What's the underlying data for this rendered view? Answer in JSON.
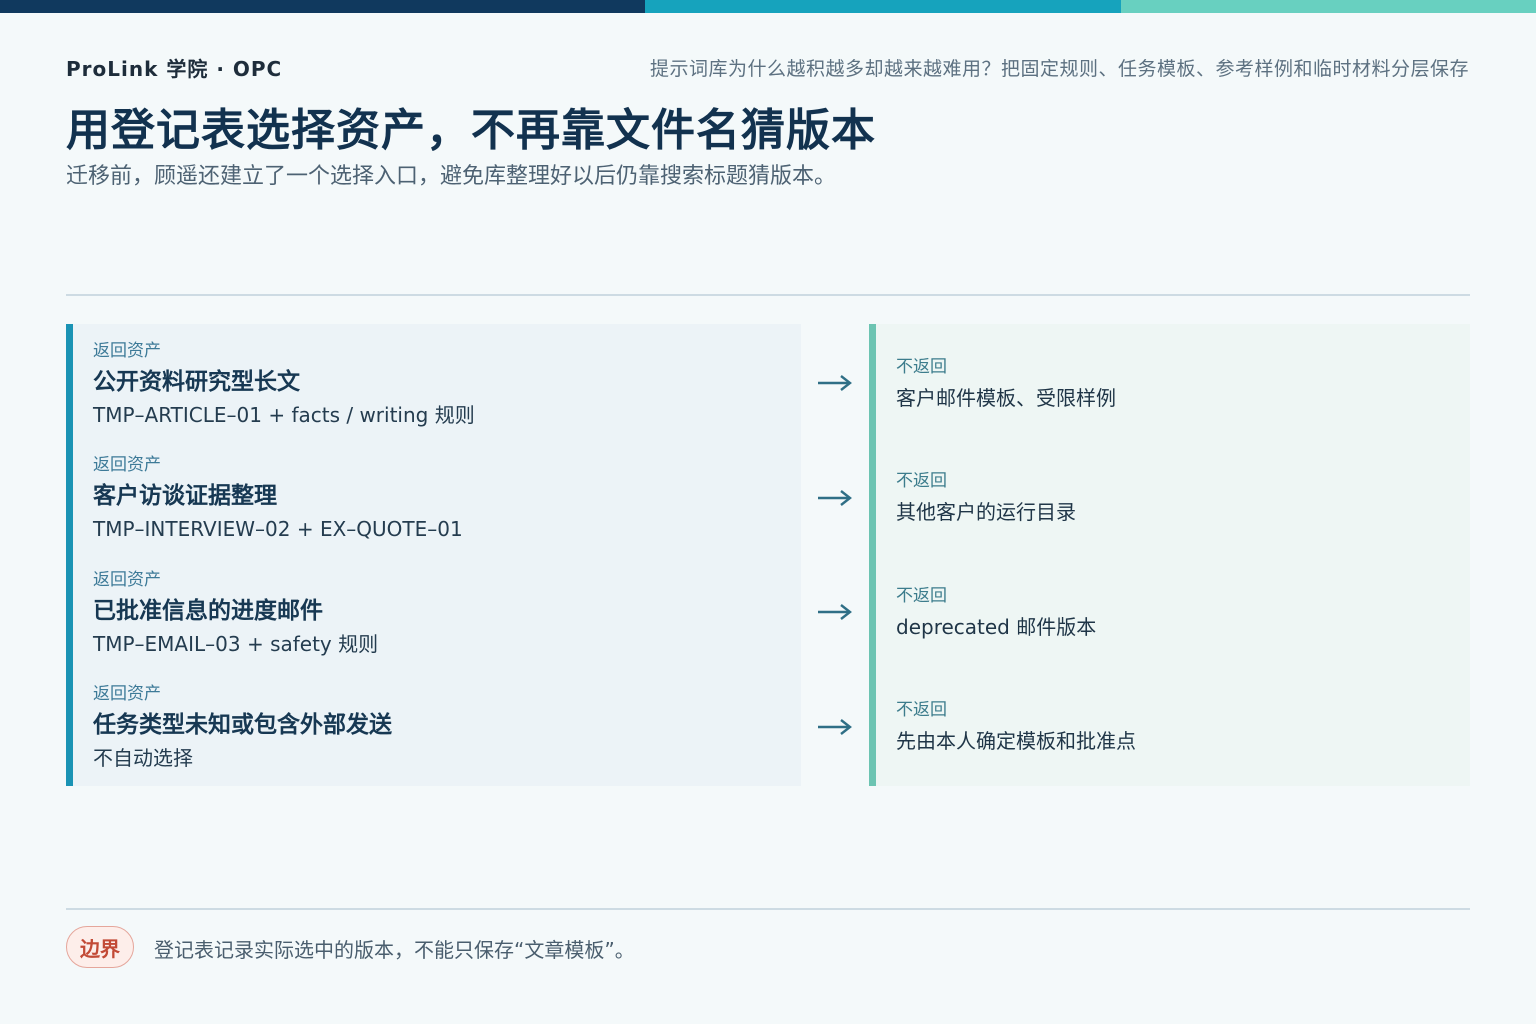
{
  "header": {
    "brand": "ProLink 学院 · OPC",
    "tagline": "提示词库为什么越积越多却越来越难用？把固定规则、任务模板、参考样例和临时材料分层保存",
    "title": "用登记表选择资产，不再靠文件名猜版本",
    "subtitle": "迁移前，顾遥还建立了一个选择入口，避免库整理好以后仍靠搜索标题猜版本。"
  },
  "left_rows": [
    {
      "label": "返回资产",
      "heading": "公开资料研究型长文",
      "detail": "TMP–ARTICLE–01 + facts / writing 规则"
    },
    {
      "label": "返回资产",
      "heading": "客户访谈证据整理",
      "detail": "TMP–INTERVIEW–02 + EX–QUOTE–01"
    },
    {
      "label": "返回资产",
      "heading": "已批准信息的进度邮件",
      "detail": "TMP–EMAIL–03 + safety 规则"
    },
    {
      "label": "返回资产",
      "heading": "任务类型未知或包含外部发送",
      "detail": "不自动选择"
    }
  ],
  "right_rows": [
    {
      "label": "不返回",
      "text": "客户邮件模板、受限样例"
    },
    {
      "label": "不返回",
      "text": "其他客户的运行目录"
    },
    {
      "label": "不返回",
      "text": "deprecated 邮件版本"
    },
    {
      "label": "不返回",
      "text": "先由本人确定模板和批准点"
    }
  ],
  "footer": {
    "badge": "边界",
    "text": "登记表记录实际选中的版本，不能只保存“文章模板”。"
  },
  "colors": {
    "navy": "#10395e",
    "teal": "#16a3bd",
    "mint": "#68d0c0",
    "arrow": "#2f6f86",
    "badge_red": "#c24a36"
  },
  "icons": {
    "arrow": "arrow-right-icon"
  }
}
